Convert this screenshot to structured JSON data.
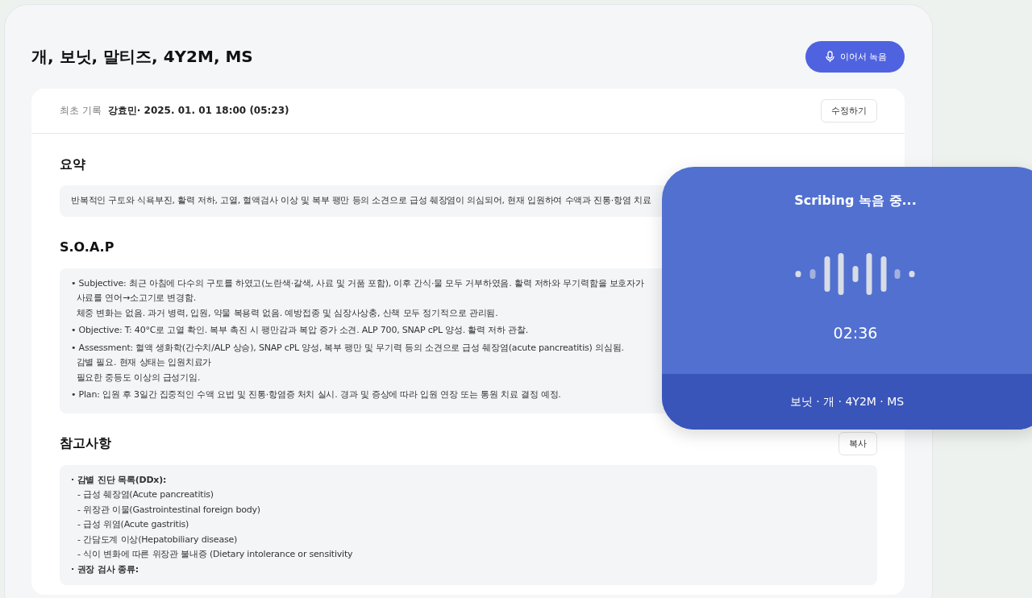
{
  "header": {
    "title": "개, 보닛, 말티즈, 4Y2M, MS",
    "record_button": "이어서 녹음"
  },
  "record_info": {
    "label": "최초 기록",
    "value": "강효민· 2025. 01. 01 18:00 (05:23)",
    "edit_button": "수정하기"
  },
  "sections": [
    {
      "kind": "paragraph",
      "title": "요약",
      "text": "반복적인 구토와 식욕부진, 활력 저하, 고열, 혈액검사 이상 및 복부 팽만 등의 소견으로 급성 췌장염이 의심되어, 현재 입원하여 수액과 진통·항염 치료"
    },
    {
      "kind": "bullets",
      "title": "S.O.A.P",
      "items": [
        {
          "lines": [
            "• Subjective: 최근 아침에 다수의 구토를 하였고(노란색·갈색, 사료 및 거품 포함), 이후 간식·물 모두 거부하였음. 활력 저하와 무기력함을 보호자가",
            "사료를 연어→소고기로 변경함.",
            "체중 변화는 없음. 과거 병력, 입원, 약물 복용력 없음. 예방접종 및 심장사상충, 산책 모두 정기적으로 관리됨."
          ]
        },
        {
          "lines": [
            "• Objective: T: 40°C로 고열 확인. 복부 촉진 시 팽만감과 복압 증가 소견. ALP 700, SNAP cPL 양성. 활력 저하 관찰."
          ]
        },
        {
          "lines": [
            "• Assessment: 혈액 생화학(간수치/ALP 상승), SNAP cPL 양성, 복부 팽만 및 무기력 등의 소견으로 급성 췌장염(acute pancreatitis) 의심됨.",
            "감별 필요. 현재 상태는 입원치료가",
            "필요한 중등도 이상의 급성기임."
          ]
        },
        {
          "lines": [
            "• Plan: 입원 후 3일간 집중적인 수액 요법 및 진통·항염증 처치 실시. 경과 및 증상에 따라 입원 연장 또는 통원 치료 결정 예정."
          ]
        }
      ]
    },
    {
      "kind": "outline",
      "title": "참고사항",
      "copy_button": "복사",
      "items": [
        {
          "text": "· 감별 진단 목록(DDx):",
          "children": [
            "- 급성 췌장염(Acute pancreatitis)",
            "- 위장관 이물(Gastrointestinal foreign body)",
            "- 급성 위염(Acute gastritis)",
            "- 간담도계 이상(Hepatobiliary disease)",
            "- 식이 변화에 따른 위장관 불내증 (Dietary intolerance or sensitivity"
          ]
        },
        {
          "text": "· 권장 검사 종류:"
        }
      ]
    }
  ],
  "recording_overlay": {
    "title": "Scribing 녹음 중...",
    "timer": "02:36",
    "patient": "보닛 · 개 · 4Y2M · MS"
  }
}
